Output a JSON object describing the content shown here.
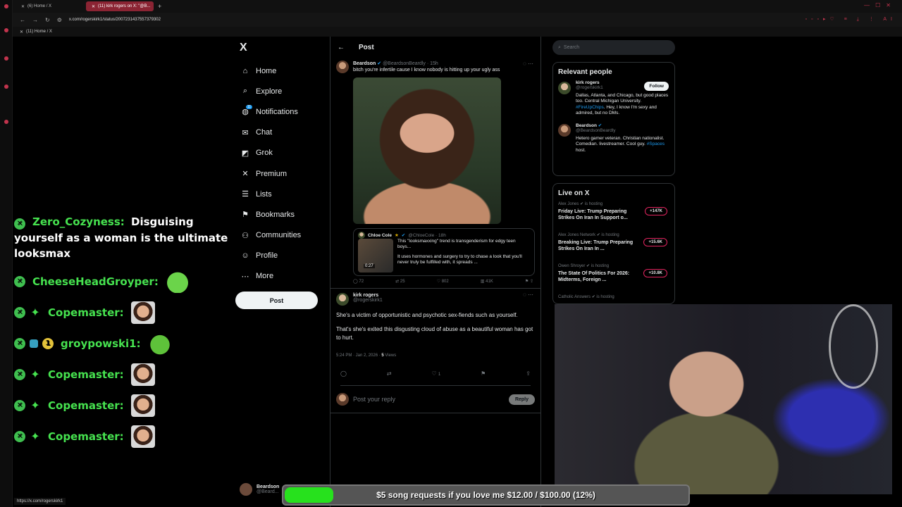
{
  "browser": {
    "tabs": [
      {
        "label": "(6) Home / X"
      },
      {
        "label": "(11) kirk rogers on X: \"@B..."
      }
    ],
    "url": "x.com/rogerskirk1/status/2007231437557379302",
    "bookmark": "(11) Home / X",
    "status_url": "https://x.com/rogerskirk1"
  },
  "nav": {
    "logo": "X",
    "items": [
      {
        "label": "Home",
        "icon": "home-icon",
        "glyph": "⌂"
      },
      {
        "label": "Explore",
        "icon": "search-icon",
        "glyph": "⌕"
      },
      {
        "label": "Notifications",
        "icon": "bell-icon",
        "glyph": "🔔",
        "badge": "11"
      },
      {
        "label": "Chat",
        "icon": "mail-icon",
        "glyph": "✉"
      },
      {
        "label": "Grok",
        "icon": "grok-icon",
        "glyph": "◩"
      },
      {
        "label": "Premium",
        "icon": "x-icon",
        "glyph": "✕"
      },
      {
        "label": "Lists",
        "icon": "lists-icon",
        "glyph": "☰"
      },
      {
        "label": "Bookmarks",
        "icon": "bookmark-icon",
        "glyph": "⚑"
      },
      {
        "label": "Communities",
        "icon": "communities-icon",
        "glyph": "⚇"
      },
      {
        "label": "Profile",
        "icon": "person-icon",
        "glyph": "☺"
      },
      {
        "label": "More",
        "icon": "more-icon",
        "glyph": "⋯"
      }
    ],
    "post_button": "Post",
    "bottom_user": {
      "name": "Beardson",
      "handle": "@Beard..."
    }
  },
  "center": {
    "header": "Post",
    "original_tweet": {
      "name": "Beardson",
      "handle": "@BeardsonBeardly · 15h",
      "text": "bitch you're infertile cause I know nobody is hitting up your ugly ass",
      "quote": {
        "name": "Chloe Cole",
        "handle": "@ChloeCole · 18h",
        "duration": "0:27",
        "text1": "This \"looksmaxxing\" trend is transgenderism for edgy teen boys...",
        "text2": "It uses hormones and surgery to try to chase a look that you'll never truly be fulfilled with, it spreads ..."
      },
      "actions": {
        "replies": "72",
        "reposts": "25",
        "likes": "802",
        "views": "41K"
      }
    },
    "reply_tweet": {
      "name": "kirk rogers",
      "handle": "@rogerskirk1",
      "text1": "She's a victim of opportunistic and psychotic sex-fiends such as yourself.",
      "text2": "That's she's exited this disgusting cloud of abuse as a beautiful woman has got to hurt.",
      "time": "5:24 PM · Jan 2, 2026 · ",
      "views_count": "5",
      "views_label": " Views",
      "likes": "1"
    },
    "reply_placeholder": "Post your reply",
    "reply_button": "Reply"
  },
  "right": {
    "search_placeholder": "Search",
    "relevant_title": "Relevant people",
    "people": [
      {
        "name": "kirk rogers",
        "handle": "@rogerskirk1",
        "bio1": "Dallas, Atlanta, and Chicago, but good places too. Central Michigan University. ",
        "tag": "#FireUpChips",
        "bio2": ". Hey, I know I'm sexy and admired, but no DMs.",
        "follow": "Follow"
      },
      {
        "name": "Beardson",
        "handle": "@BeardsonBeardly",
        "bio1": "Hetero gamer veteran. Christian nationalist. Comedian. livestreamer. Cool guy. ",
        "tag": "#Spaces",
        "bio2": " host."
      }
    ],
    "live_title": "Live on X",
    "live": [
      {
        "host": "Alex Jones",
        "status": " is hosting",
        "title": "Friday Live: Trump Preparing Strikes On Iran In Support o...",
        "count": "+147K"
      },
      {
        "host": "Alex Jones Network",
        "status": " is hosting",
        "title": "Breaking Live: Trump Preparing Strikes On Iran In ...",
        "count": "+15.6K"
      },
      {
        "host": "Owen Shroyer",
        "status": " is hosting",
        "title": "The State Of Politics For 2026: Midterms, Foreign ...",
        "count": "+10.8K"
      },
      {
        "host": "Catholic Answers",
        "status": " is hosting",
        "title": "",
        "count": ""
      }
    ]
  },
  "chat": [
    {
      "user": "Zero_Cozyness:",
      "message": "Disguising yourself as a woman is the ultimate looksmax",
      "emote": ""
    },
    {
      "user": "CheeseHeadGroyper:",
      "message": "",
      "emote": "pepe"
    },
    {
      "user": "Copemaster:",
      "message": "",
      "emote": "face"
    },
    {
      "user": "groypowski1:",
      "message": "",
      "emote": "heart"
    },
    {
      "user": "Copemaster:",
      "message": "",
      "emote": "face"
    },
    {
      "user": "Copemaster:",
      "message": "",
      "emote": "face"
    },
    {
      "user": "Copemaster:",
      "message": "",
      "emote": "face"
    }
  ],
  "goal": {
    "text": "$5 song requests if you love me $12.00 / $100.00 (12%)",
    "progress_fraction": 0.12
  },
  "colors": {
    "accent_blue": "#1d9bf0",
    "chat_green": "#46e24f",
    "goal_green": "#27e11d",
    "browser_red": "#c2344d"
  }
}
